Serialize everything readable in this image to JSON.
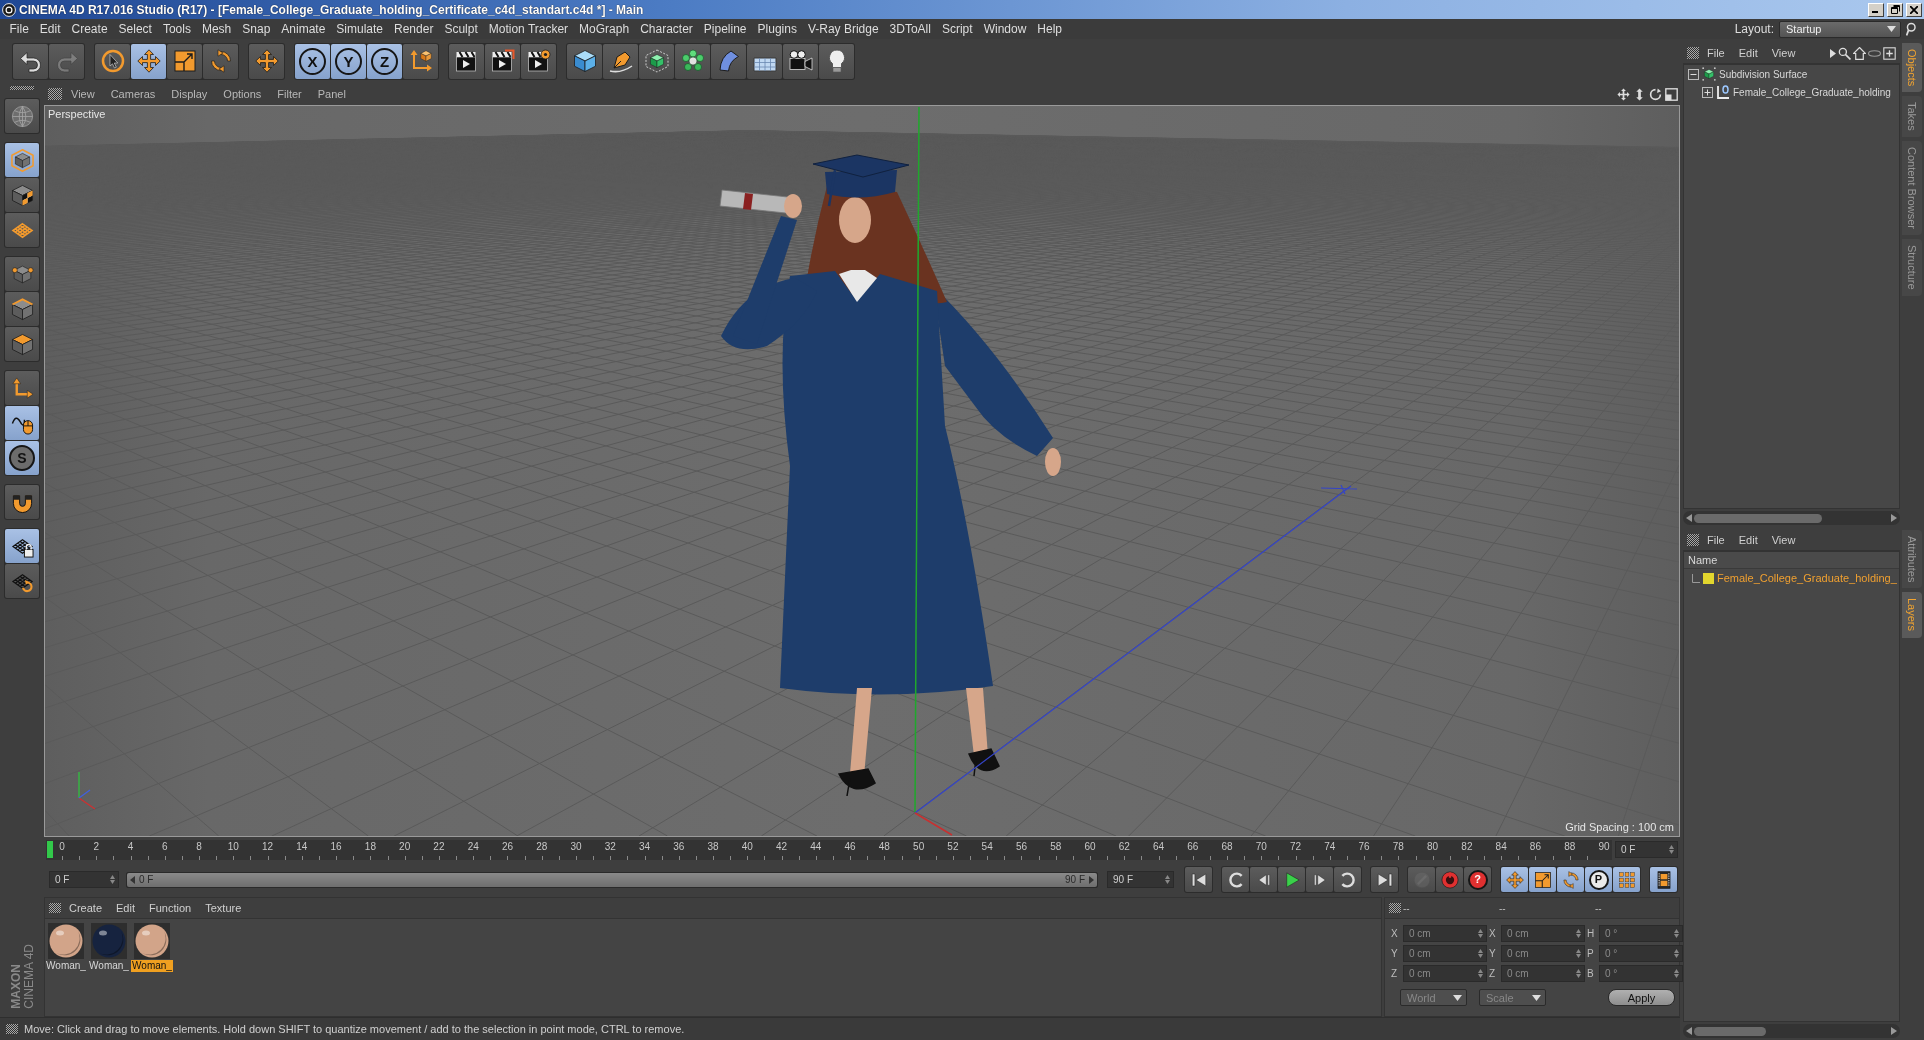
{
  "window": {
    "title": "CINEMA 4D R17.016 Studio (R17) - [Female_College_Graduate_holding_Certificate_c4d_standart.c4d *] - Main"
  },
  "menu_bar": [
    "File",
    "Edit",
    "Create",
    "Select",
    "Tools",
    "Mesh",
    "Snap",
    "Animate",
    "Simulate",
    "Render",
    "Sculpt",
    "Motion Tracker",
    "MoGraph",
    "Character",
    "Pipeline",
    "Plugins",
    "V-Ray Bridge",
    "3DToAll",
    "Script",
    "Window",
    "Help"
  ],
  "layout": {
    "label": "Layout:",
    "value": "Startup"
  },
  "toolbar": [
    [
      {
        "selected": false,
        "disabled": false
      },
      {
        "selected": false,
        "disabled": true
      }
    ],
    [
      {
        "selected": false,
        "disabled": false
      },
      {
        "selected": true,
        "disabled": false
      },
      {
        "selected": false,
        "disabled": false
      },
      {
        "selected": false,
        "disabled": false
      }
    ],
    [
      {
        "selected": false,
        "disabled": false
      }
    ],
    [
      {
        "label": "X",
        "selected": true,
        "disabled": false
      },
      {
        "label": "Y",
        "selected": true,
        "disabled": false
      },
      {
        "label": "Z",
        "selected": true,
        "disabled": false
      },
      {
        "selected": false,
        "disabled": false
      }
    ],
    [
      {
        "selected": false,
        "disabled": false
      },
      {
        "selected": false,
        "disabled": false
      },
      {
        "selected": false,
        "disabled": false
      }
    ],
    [
      {
        "selected": false,
        "disabled": false
      },
      {
        "selected": false,
        "disabled": false
      },
      {
        "selected": false,
        "disabled": false
      },
      {
        "selected": false,
        "disabled": false
      },
      {
        "selected": false,
        "disabled": false
      },
      {
        "selected": false,
        "disabled": false
      },
      {
        "selected": false,
        "disabled": false
      },
      {
        "selected": false,
        "disabled": false
      }
    ]
  ],
  "mode_palette": [
    [
      {
        "selected": false
      }
    ],
    [
      {
        "selected": true
      },
      {
        "selected": false
      },
      {
        "selected": false
      }
    ],
    [
      {
        "selected": false
      },
      {
        "selected": false
      },
      {
        "selected": false
      }
    ],
    [
      {
        "selected": false
      },
      {
        "selected": true
      },
      {
        "label": "S",
        "selected": true
      }
    ],
    [
      {
        "selected": false
      }
    ],
    [
      {
        "selected": true
      },
      {
        "selected": false
      }
    ]
  ],
  "brand": [
    "MAXON",
    "CINEMA 4D"
  ],
  "viewport": {
    "menu": [
      "View",
      "Cameras",
      "Display",
      "Options",
      "Filter",
      "Panel"
    ],
    "camera": "Perspective",
    "grid_spacing": "Grid Spacing : 100 cm"
  },
  "timeline": {
    "ticks": [
      "0",
      "2",
      "4",
      "6",
      "8",
      "10",
      "12",
      "14",
      "16",
      "18",
      "20",
      "22",
      "24",
      "26",
      "28",
      "30",
      "32",
      "34",
      "36",
      "38",
      "40",
      "42",
      "44",
      "46",
      "48",
      "50",
      "52",
      "54",
      "56",
      "58",
      "60",
      "62",
      "64",
      "66",
      "68",
      "70",
      "72",
      "74",
      "76",
      "78",
      "80",
      "82",
      "84",
      "86",
      "88",
      "90"
    ],
    "playhead": {
      "level": 0
    },
    "current_frame": "0 F"
  },
  "transport": {
    "start_field": "0 F",
    "range": {
      "start": "0 F",
      "end": "90 F",
      "level": 1
    },
    "end_field": "90 F",
    "buttons": [
      [
        {
          "selected": false,
          "disabled": false
        }
      ],
      [
        {
          "selected": false,
          "disabled": false
        },
        {
          "selected": false,
          "disabled": false
        },
        {
          "selected": false,
          "disabled": false
        },
        {
          "selected": false,
          "disabled": false
        },
        {
          "selected": false,
          "disabled": false
        }
      ],
      [
        {
          "selected": false,
          "disabled": false
        }
      ],
      [
        {
          "selected": false,
          "disabled": true
        },
        {
          "selected": false,
          "disabled": false
        },
        {
          "label": "?",
          "selected": false,
          "disabled": false
        }
      ],
      [
        {
          "selected": true,
          "disabled": false
        },
        {
          "selected": true,
          "disabled": false
        },
        {
          "selected": true,
          "disabled": false
        },
        {
          "label": "P",
          "selected": true,
          "disabled": false
        },
        {
          "selected": true,
          "disabled": false
        }
      ],
      [
        {
          "selected": true,
          "disabled": false
        }
      ]
    ]
  },
  "materials": {
    "menu": [
      "Create",
      "Edit",
      "Function",
      "Texture"
    ],
    "items": [
      {
        "label": "Woman_",
        "color": "#d2a489",
        "selected": false
      },
      {
        "label": "Woman_",
        "color": "#16233f",
        "selected": false
      },
      {
        "label": "Woman_",
        "color": "#d2a489",
        "selected": true
      }
    ]
  },
  "coordinates": {
    "headers": [
      "--",
      "--",
      "--"
    ],
    "rows": [
      [
        {
          "axis": "X",
          "value": "0 cm"
        },
        {
          "axis": "X",
          "value": "0 cm"
        },
        {
          "axis": "H",
          "value": "0 °"
        }
      ],
      [
        {
          "axis": "Y",
          "value": "0 cm"
        },
        {
          "axis": "Y",
          "value": "0 cm"
        },
        {
          "axis": "P",
          "value": "0 °"
        }
      ],
      [
        {
          "axis": "Z",
          "value": "0 cm"
        },
        {
          "axis": "Z",
          "value": "0 cm"
        },
        {
          "axis": "B",
          "value": "0 °"
        }
      ]
    ],
    "mode": "World",
    "transform": "Scale",
    "apply": "Apply"
  },
  "status_bar": "Move: Click and drag to move elements. Hold down SHIFT to quantize movement / add to the selection in point mode, CTRL to remove.",
  "object_manager": {
    "menu": [
      "File",
      "Edit",
      "View"
    ],
    "tree": [
      {
        "name": "Subdivision Surface",
        "expanded": true,
        "children": [
          {
            "name": "Female_College_Graduate_holding",
            "expanded": false
          }
        ]
      }
    ]
  },
  "object_tabs": [
    {
      "label": "Objects",
      "selected": true
    },
    {
      "label": "Takes",
      "selected": false
    },
    {
      "label": "Content Browser",
      "selected": false
    },
    {
      "label": "Structure",
      "selected": false
    }
  ],
  "layer_manager": {
    "menu": [
      "File",
      "Edit",
      "View"
    ],
    "column": "Name",
    "layers": [
      {
        "name": "Female_College_Graduate_holding_",
        "color": "#e2d62e"
      }
    ]
  },
  "layer_tabs": [
    {
      "label": "Attributes",
      "selected": false
    },
    {
      "label": "Layers",
      "selected": true
    }
  ]
}
